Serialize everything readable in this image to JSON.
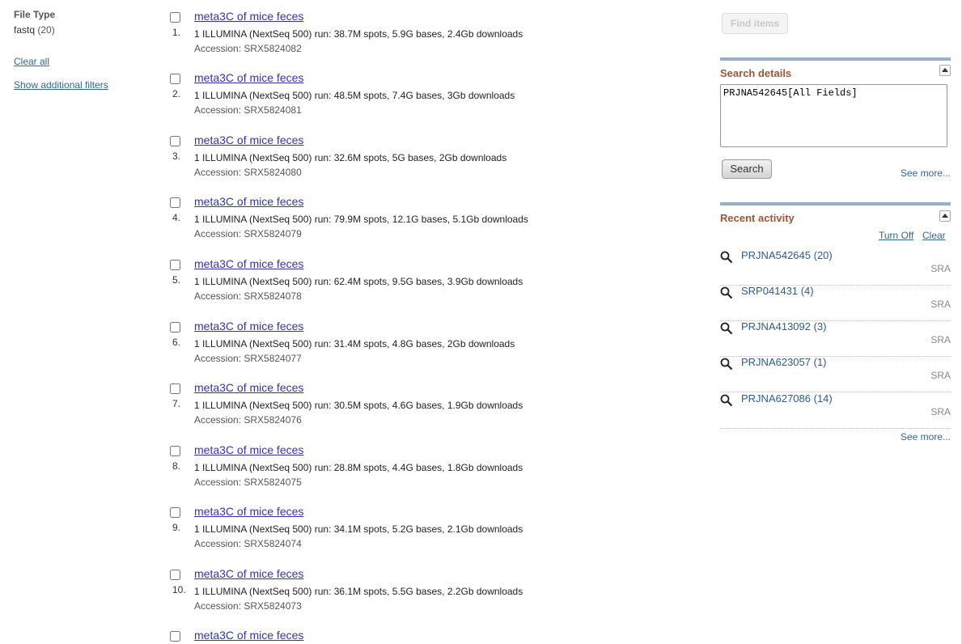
{
  "left": {
    "filter_title": "File Type",
    "filter_value": "fastq",
    "filter_count": "(20)",
    "clear_all": "Clear all",
    "show_additional": "Show additional filters"
  },
  "results": [
    {
      "num": "1.",
      "title": "meta3C of mice feces",
      "desc": "1 ILLUMINA (NextSeq 500) run: 38.7M spots, 5.9G bases, 2.4Gb downloads",
      "accession": "Accession: SRX5824082"
    },
    {
      "num": "2.",
      "title": "meta3C of mice feces",
      "desc": "1 ILLUMINA (NextSeq 500) run: 48.5M spots, 7.4G bases, 3Gb downloads",
      "accession": "Accession: SRX5824081"
    },
    {
      "num": "3.",
      "title": "meta3C of mice feces",
      "desc": "1 ILLUMINA (NextSeq 500) run: 32.6M spots, 5G bases, 2Gb downloads",
      "accession": "Accession: SRX5824080"
    },
    {
      "num": "4.",
      "title": "meta3C of mice feces",
      "desc": "1 ILLUMINA (NextSeq 500) run: 79.9M spots, 12.1G bases, 5.1Gb downloads",
      "accession": "Accession: SRX5824079"
    },
    {
      "num": "5.",
      "title": "meta3C of mice feces",
      "desc": "1 ILLUMINA (NextSeq 500) run: 62.4M spots, 9.5G bases, 3.9Gb downloads",
      "accession": "Accession: SRX5824078"
    },
    {
      "num": "6.",
      "title": "meta3C of mice feces",
      "desc": "1 ILLUMINA (NextSeq 500) run: 31.4M spots, 4.8G bases, 2Gb downloads",
      "accession": "Accession: SRX5824077"
    },
    {
      "num": "7.",
      "title": "meta3C of mice feces",
      "desc": "1 ILLUMINA (NextSeq 500) run: 30.5M spots, 4.6G bases, 1.9Gb downloads",
      "accession": "Accession: SRX5824076"
    },
    {
      "num": "8.",
      "title": "meta3C of mice feces",
      "desc": "1 ILLUMINA (NextSeq 500) run: 28.8M spots, 4.4G bases, 1.8Gb downloads",
      "accession": "Accession: SRX5824075"
    },
    {
      "num": "9.",
      "title": "meta3C of mice feces",
      "desc": "1 ILLUMINA (NextSeq 500) run: 34.1M spots, 5.2G bases, 2.1Gb downloads",
      "accession": "Accession: SRX5824074"
    },
    {
      "num": "10.",
      "title": "meta3C of mice feces",
      "desc": "1 ILLUMINA (NextSeq 500) run: 36.1M spots, 5.5G bases, 2.2Gb downloads",
      "accession": "Accession: SRX5824073"
    },
    {
      "num": "",
      "title": "meta3C of mice feces",
      "desc": "",
      "accession": ""
    }
  ],
  "right": {
    "find_items": "Find items",
    "search_details_title": "Search details",
    "query": "PRJNA542645[All Fields]",
    "search_button": "Search",
    "see_more_1": "See more...",
    "recent_activity_title": "Recent activity",
    "turn_off": "Turn Off",
    "clear": "Clear",
    "recent": [
      {
        "label": "PRJNA542645 (20)",
        "db": "SRA"
      },
      {
        "label": "SRP041431 (4)",
        "db": "SRA"
      },
      {
        "label": "PRJNA413092 (3)",
        "db": "SRA"
      },
      {
        "label": "PRJNA623057 (1)",
        "db": "SRA"
      },
      {
        "label": "PRJNA627086 (14)",
        "db": "SRA"
      }
    ],
    "see_more_2": "See more..."
  }
}
